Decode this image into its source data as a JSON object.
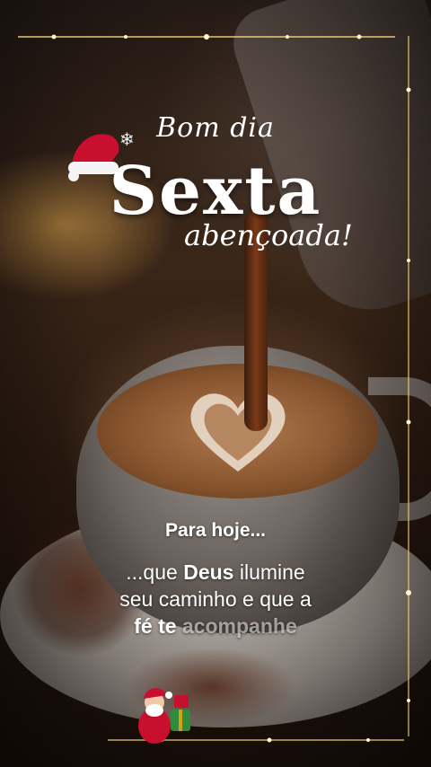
{
  "greeting": {
    "bom_dia": "Bom dia",
    "day": "Sexta",
    "blessed": "abençoada!"
  },
  "message": {
    "intro": "Para hoje...",
    "line1_prefix": "...que ",
    "line1_bold": "Deus",
    "line1_suffix": " ilumine",
    "line2": "seu caminho e que a",
    "line3_bold": "fé te",
    "line3_faded": " acompanhe"
  },
  "icons": [
    "santa-hat-icon",
    "snowflake-icon",
    "santa-claus-icon",
    "sparkle-border-icon",
    "latte-heart-icon"
  ],
  "colors": {
    "text": "#ffffff",
    "coffee": "#8a5630",
    "hat_red": "#c8102e",
    "sparkle": "#f7d27a"
  }
}
